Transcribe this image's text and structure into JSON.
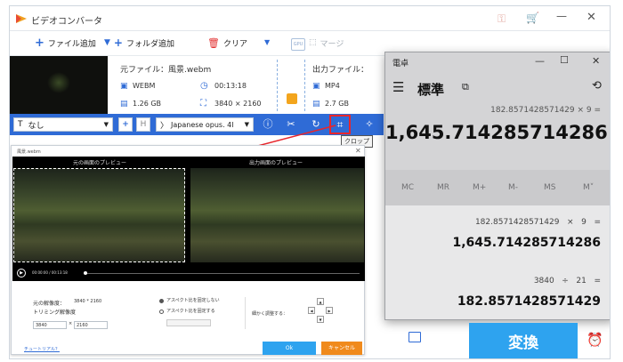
{
  "app": {
    "title": "ビデオコンバータ"
  },
  "toolbar": {
    "add_file": "ファイル追加",
    "add_folder": "フォルダ追加",
    "clear": "クリア",
    "gpu": "GPU",
    "merge": "マージ"
  },
  "file": {
    "source_label": "元ファイル：風景.webm",
    "format": "WEBM",
    "duration": "00:13:18",
    "size": "1.26 GB",
    "resolution": "3840 × 2160",
    "output_label": "出力ファイル：",
    "out_format": "MP4",
    "out_size": "2.7 GB"
  },
  "options": {
    "subtitle": "なし",
    "audio": "Japanese opus. 4l",
    "tooltip": "クロップ"
  },
  "dialog": {
    "title": "風景.webm",
    "original_preview": "元の画面のプレビュー",
    "output_preview": "出力画面のプレビュー",
    "time": "00:00:00 / 00:13:18",
    "orig_res_label": "元の解像度：",
    "orig_res_value": "3840 * 2160",
    "trim_res_label": "トリミング解像度",
    "width": "3840",
    "height": "2160",
    "aspect_keep": "アスペクト比を固定しない",
    "aspect_fix": "アスペクト比を固定する",
    "fine_adjust": "細かく調整する：",
    "tutorial": "チュートリアル？",
    "ok": "Ok",
    "cancel": "キャンセル"
  },
  "calc": {
    "title": "電卓",
    "mode": "標準",
    "expression": "182.8571428571429 × 9 =",
    "result": "1,645.714285714286",
    "memory": [
      "MC",
      "MR",
      "M+",
      "M-",
      "MS",
      "M˅"
    ],
    "history": [
      {
        "expr": "182.8571428571429   ×   9   =",
        "value": "1,645.714285714286"
      },
      {
        "expr": "3840   ÷   21   =",
        "value": "182.8571428571429"
      }
    ]
  },
  "bottom": {
    "convert": "変換"
  },
  "colors": {
    "accent": "#2f6bd6",
    "convert": "#2ea3ef",
    "highlight": "#e8262c",
    "ok": "#2ea3ef",
    "cancel": "#f08a1c"
  }
}
